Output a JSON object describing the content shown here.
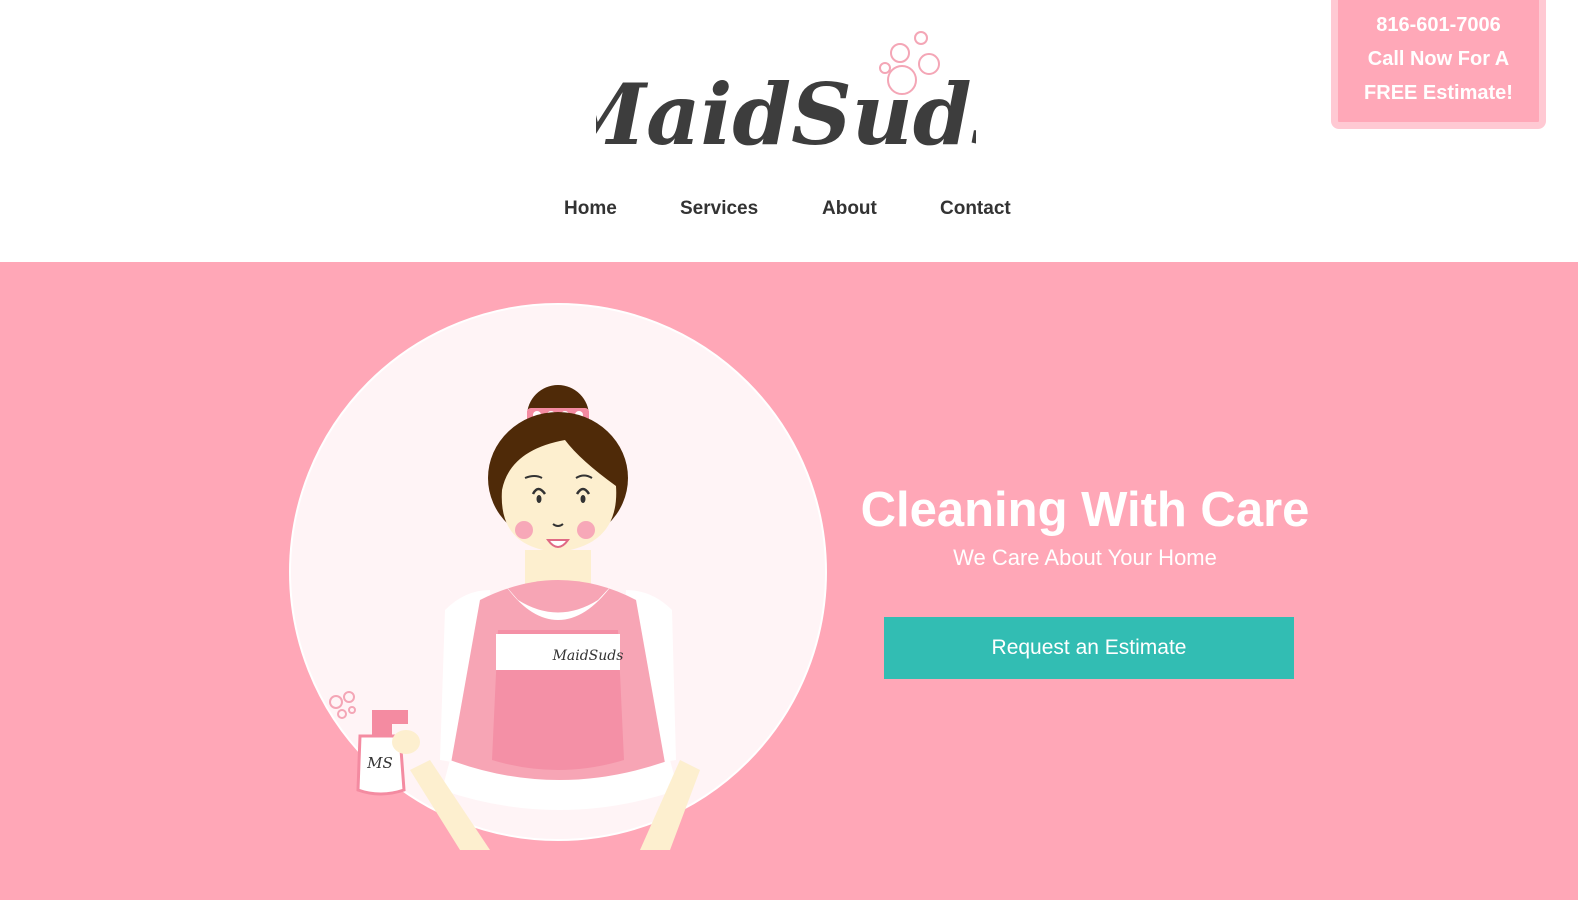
{
  "brand": {
    "logo_text": "MaidSuds"
  },
  "nav": {
    "items": [
      "Home",
      "Services",
      "About",
      "Contact"
    ]
  },
  "callout": {
    "phone": "816-601-7006",
    "line1": "Call Now For A",
    "line2": "FREE Estimate!"
  },
  "hero": {
    "title": "Cleaning With Care",
    "subtitle": "We Care About Your Home",
    "cta_label": "Request an Estimate",
    "apron_logo": "MaidSuds",
    "bottle_label": "MS"
  },
  "colors": {
    "brand_pink": "#ffa7b7",
    "callout_border": "#ffc9d3",
    "accent_teal": "#32bdb3",
    "logo_text": "#3d3d3d",
    "nav_text": "#333333"
  }
}
